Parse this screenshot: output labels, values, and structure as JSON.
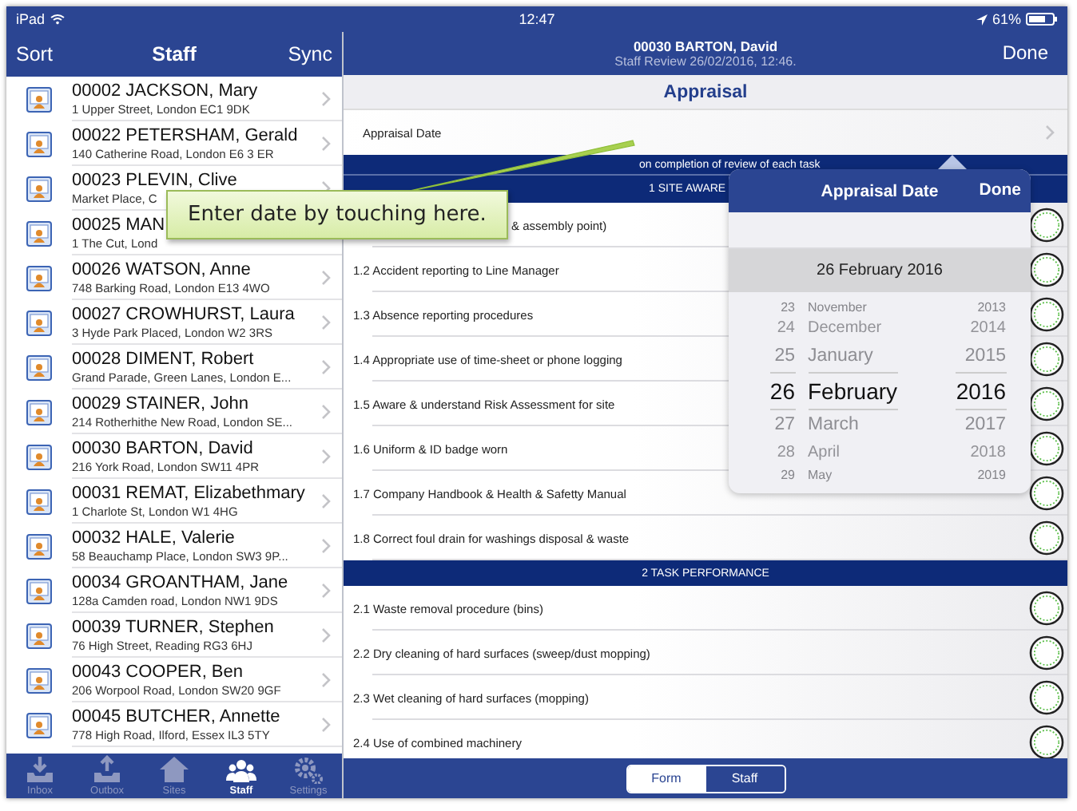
{
  "status_bar": {
    "device": "iPad",
    "time": "12:47",
    "battery": "61%"
  },
  "staff_panel": {
    "sort": "Sort",
    "title": "Staff",
    "sync": "Sync",
    "items": [
      {
        "name": "00002 JACKSON, Mary",
        "address": "1 Upper Street, London EC1 9DK",
        "chevron": true
      },
      {
        "name": "00022 PETERSHAM, Gerald",
        "address": "140 Catherine Road, London E6 3 ER",
        "chevron": true
      },
      {
        "name": "00023 PLEVIN, Clive",
        "address": "Market Place, C",
        "chevron": true
      },
      {
        "name": "00025 MAN",
        "address": "1 The Cut, Lond",
        "chevron": false
      },
      {
        "name": "00026 WATSON, Anne",
        "address": "748 Barking Road, London E13 4WO",
        "chevron": true
      },
      {
        "name": "00027 CROWHURST, Laura",
        "address": "3 Hyde Park Placed, London W2 3RS",
        "chevron": true
      },
      {
        "name": "00028 DIMENT, Robert",
        "address": "Grand Parade, Green Lanes, London E...",
        "chevron": true
      },
      {
        "name": "00029 STAINER, John",
        "address": "214 Rotherhithe New Road, London SE...",
        "chevron": true
      },
      {
        "name": "00030 BARTON, David",
        "address": "216 York Road, London SW11 4PR",
        "chevron": true
      },
      {
        "name": "00031 REMAT, Elizabethmary",
        "address": "1 Charlote St, London W1 4HG",
        "chevron": true
      },
      {
        "name": "00032 HALE, Valerie",
        "address": "58 Beauchamp Place, London SW3 9P...",
        "chevron": true
      },
      {
        "name": "00034 GROANTHAM, Jane",
        "address": "128a Camden road, London NW1 9DS",
        "chevron": true
      },
      {
        "name": "00039 TURNER, Stephen",
        "address": "76 High Street, Reading RG3 6HJ",
        "chevron": true
      },
      {
        "name": "00043 COOPER, Ben",
        "address": "206 Worpool Road, London SW20 9GF",
        "chevron": true
      },
      {
        "name": "00045 BUTCHER, Annette",
        "address": "778 High Road, Ilford, Essex IL3 5TY",
        "chevron": true
      }
    ]
  },
  "tab_bar": [
    {
      "label": "Inbox",
      "kind": "inbox",
      "selected": false
    },
    {
      "label": "Outbox",
      "kind": "outbox",
      "selected": false
    },
    {
      "label": "Sites",
      "kind": "sites",
      "selected": false
    },
    {
      "label": "Staff",
      "kind": "staff",
      "selected": true
    },
    {
      "label": "Settings",
      "kind": "settings",
      "selected": false
    }
  ],
  "form": {
    "title": "00030 BARTON, David",
    "subtitle": "Staff Review 26/02/2016, 12:46.",
    "done": "Done",
    "section": "Appraisal",
    "date_label": "Appraisal Date",
    "instruction": "on completion of review of each task",
    "groups": [
      {
        "title": "1 SITE AWARE",
        "items": [
          "& assembly point)",
          "1.2 Accident reporting to Line Manager",
          "1.3 Absence reporting procedures",
          "1.4 Appropriate use of time-sheet or phone logging",
          "1.5 Aware & understand Risk Assessment for site",
          "1.6 Uniform & ID badge worn",
          "1.7 Company Handbook & Health & Safetty Manual",
          "1.8 Correct foul drain for washings disposal & waste"
        ]
      },
      {
        "title": "2 TASK PERFORMANCE",
        "items": [
          "2.1 Waste removal procedure (bins)",
          "2.2 Dry cleaning of hard surfaces (sweep/dust mopping)",
          "2.3 Wet cleaning of hard surfaces (mopping)",
          "2.4 Use of combined machinery"
        ]
      }
    ],
    "segments": [
      {
        "label": "Form",
        "selected": true
      },
      {
        "label": "Staff",
        "selected": false
      }
    ]
  },
  "date_picker": {
    "title": "Appraisal Date",
    "done": "Done",
    "value": "26 February 2016",
    "days": [
      {
        "label": "23",
        "selected": false
      },
      {
        "label": "24",
        "selected": false
      },
      {
        "label": "25",
        "selected": false
      },
      {
        "label": "26",
        "selected": true
      },
      {
        "label": "27",
        "selected": false
      },
      {
        "label": "28",
        "selected": false
      },
      {
        "label": "29",
        "selected": false
      }
    ],
    "months": [
      {
        "label": "November",
        "selected": false
      },
      {
        "label": "December",
        "selected": false
      },
      {
        "label": "January",
        "selected": false
      },
      {
        "label": "February",
        "selected": true
      },
      {
        "label": "March",
        "selected": false
      },
      {
        "label": "April",
        "selected": false
      },
      {
        "label": "May",
        "selected": false
      }
    ],
    "years": [
      {
        "label": "2013",
        "selected": false
      },
      {
        "label": "2014",
        "selected": false
      },
      {
        "label": "2015",
        "selected": false
      },
      {
        "label": "2016",
        "selected": true
      },
      {
        "label": "2017",
        "selected": false
      },
      {
        "label": "2018",
        "selected": false
      },
      {
        "label": "2019",
        "selected": false
      }
    ]
  },
  "callout": {
    "text": "Enter date by touching here."
  }
}
